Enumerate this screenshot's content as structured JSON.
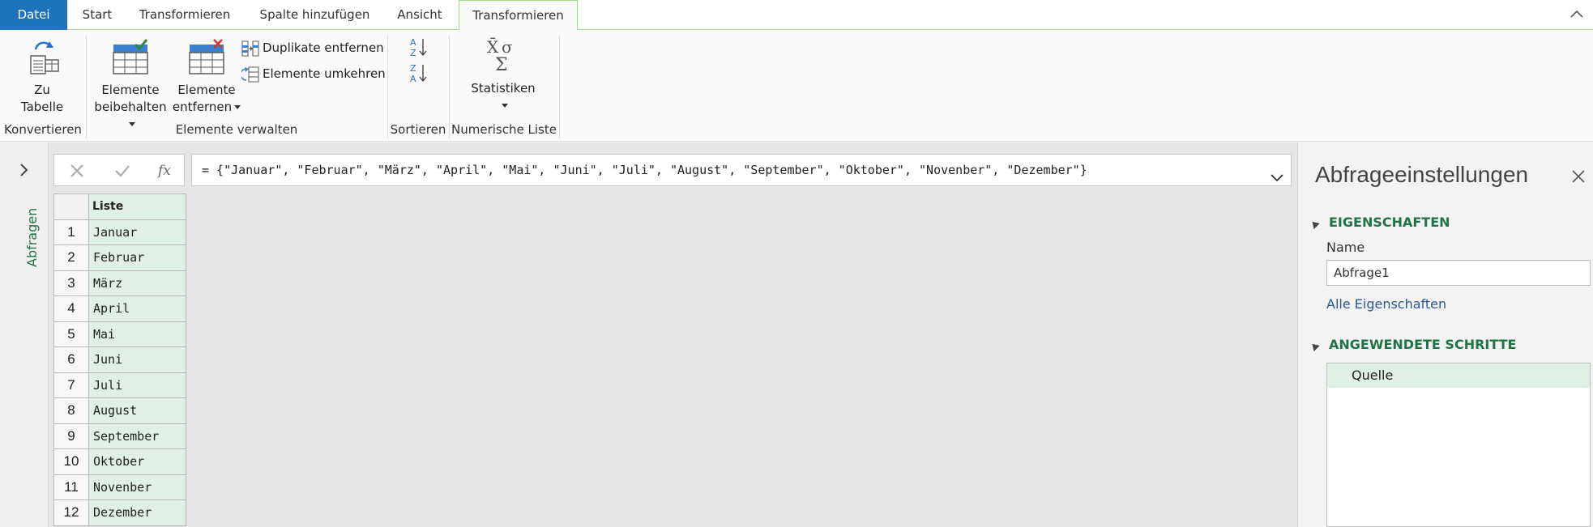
{
  "tabs": {
    "file": "Datei",
    "start": "Start",
    "transform": "Transformieren",
    "add_column": "Spalte hinzufügen",
    "view": "Ansicht",
    "transform_active": "Transformieren"
  },
  "ribbon": {
    "to_table_line1": "Zu",
    "to_table_line2": "Tabelle",
    "keep_items_line1": "Elemente",
    "keep_items_line2": "beibehalten",
    "remove_items_line1": "Elemente",
    "remove_items_line2": "entfernen",
    "remove_duplicates": "Duplikate entfernen",
    "reverse_items": "Elemente umkehren",
    "statistics": "Statistiken",
    "groups": {
      "convert": "Konvertieren",
      "manage_items": "Elemente verwalten",
      "sort": "Sortieren",
      "numeric_list": "Numerische Liste"
    }
  },
  "left_rail": {
    "label": "Abfragen"
  },
  "formula_bar": {
    "formula": "= {\"Januar\", \"Februar\", \"März\", \"April\", \"Mai\", \"Juni\", \"Juli\", \"August\", \"September\", \"Oktober\", \"Novenber\", \"Dezember\"}"
  },
  "grid": {
    "column_header": "Liste",
    "rows": [
      {
        "n": "1",
        "v": "Januar"
      },
      {
        "n": "2",
        "v": "Februar"
      },
      {
        "n": "3",
        "v": "März"
      },
      {
        "n": "4",
        "v": "April"
      },
      {
        "n": "5",
        "v": "Mai"
      },
      {
        "n": "6",
        "v": "Juni"
      },
      {
        "n": "7",
        "v": "Juli"
      },
      {
        "n": "8",
        "v": "August"
      },
      {
        "n": "9",
        "v": "September"
      },
      {
        "n": "10",
        "v": "Oktober"
      },
      {
        "n": "11",
        "v": "Novenber"
      },
      {
        "n": "12",
        "v": "Dezember"
      }
    ]
  },
  "query_settings": {
    "title": "Abfrageeinstellungen",
    "properties_heading": "EIGENSCHAFTEN",
    "name_label": "Name",
    "name_value": "Abfrage1",
    "all_properties_link": "Alle Eigenschaften",
    "applied_steps_heading": "ANGEWENDETE SCHRITTE",
    "steps": [
      "Quelle"
    ]
  },
  "colors": {
    "file_tab": "#1e73be",
    "accent_green": "#217346",
    "selection_green": "#dff0e4"
  }
}
